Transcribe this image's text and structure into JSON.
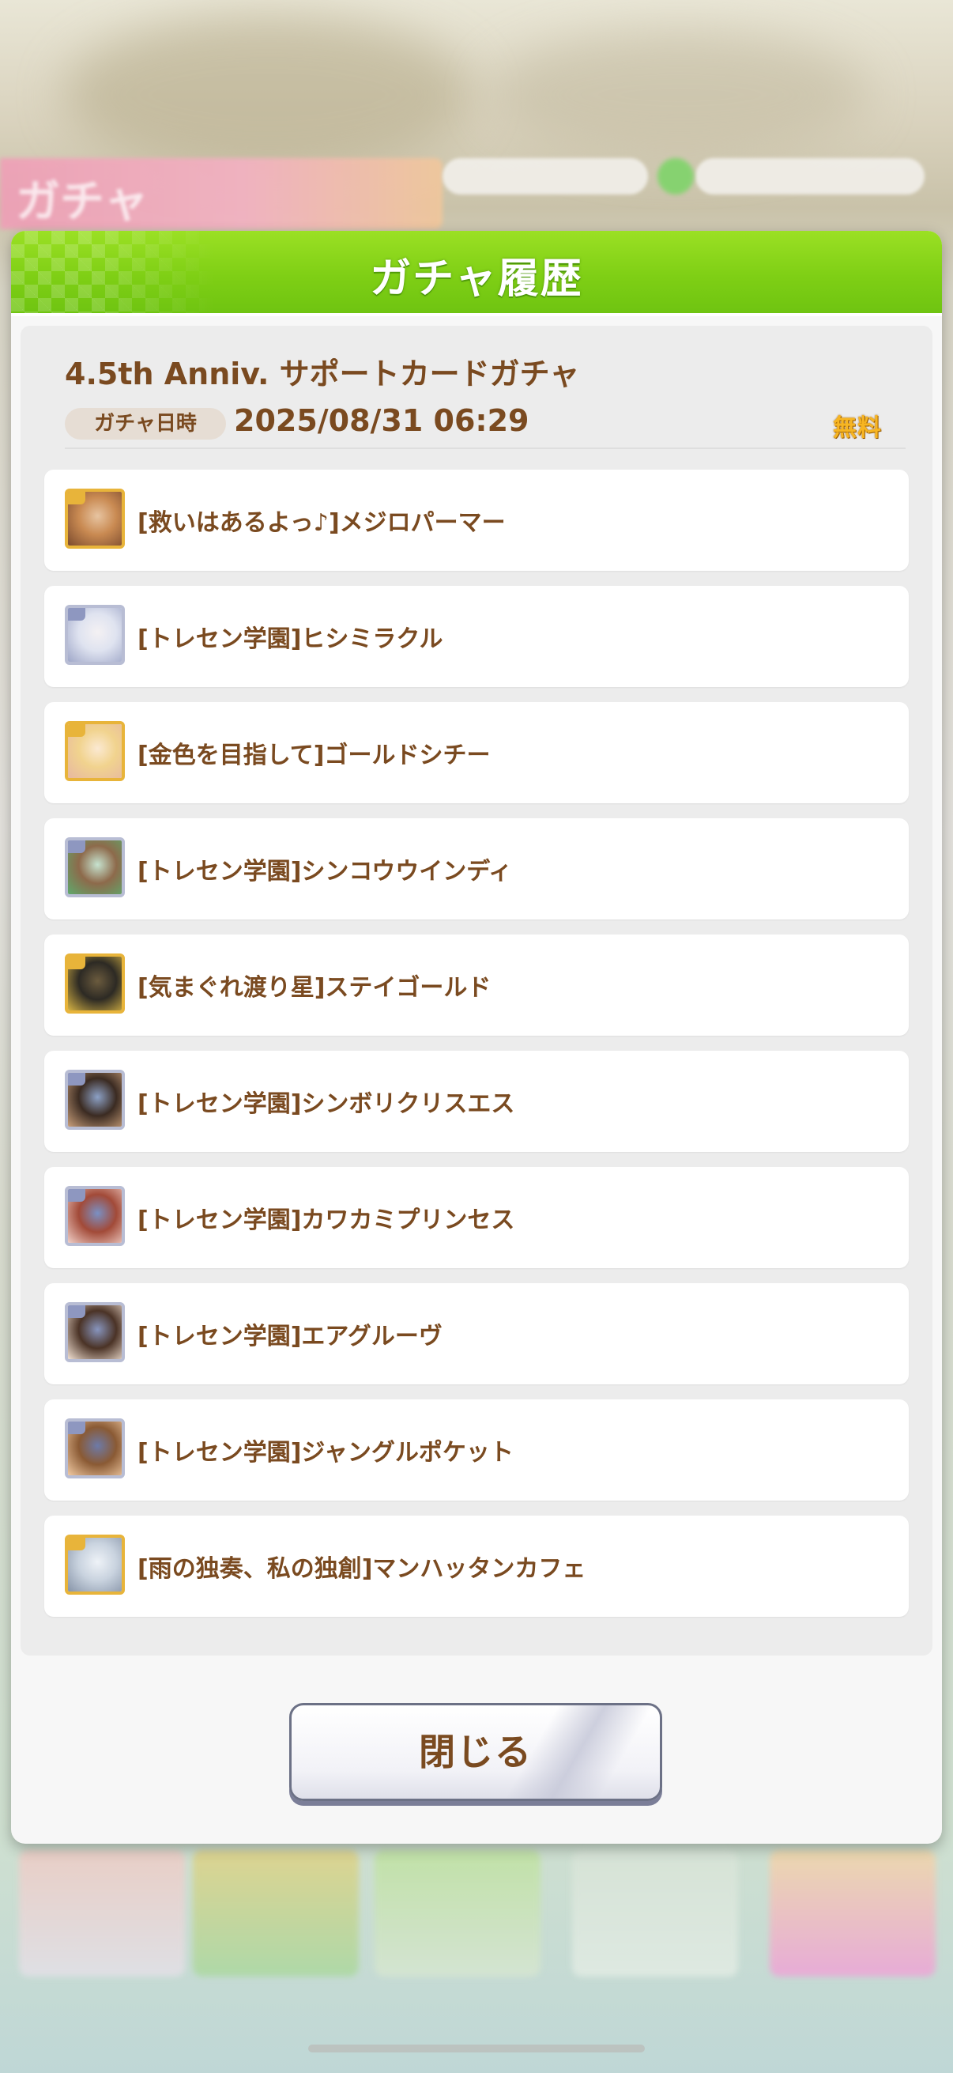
{
  "background": {
    "header_label": "ガチャ"
  },
  "dialog": {
    "title": "ガチャ履歴",
    "banner_name": "4.5th Anniv. サポートカードガチャ",
    "date_label": "ガチャ日時",
    "date_value": "2025/08/31 06:29",
    "free_badge": "無料",
    "results": [
      {
        "name": "[救いはあるよっ♪]メジロパーマー",
        "rarity": "SSR",
        "art_colors": [
          "#c98a52",
          "#7c4b2e",
          "#e7c4a1"
        ]
      },
      {
        "name": "[トレセン学園]ヒシミラクル",
        "rarity": "SR",
        "art_colors": [
          "#dfe3f0",
          "#9fa7c8",
          "#f4f1f3"
        ]
      },
      {
        "name": "[金色を目指して]ゴールドシチー",
        "rarity": "SSR",
        "art_colors": [
          "#f1d38e",
          "#e7b8a1",
          "#fbe9d2"
        ]
      },
      {
        "name": "[トレセン学園]シンコウウインディ",
        "rarity": "SR",
        "art_colors": [
          "#8d6a4b",
          "#5fa96c",
          "#c6e3cf"
        ]
      },
      {
        "name": "[気まぐれ渡り星]ステイゴールド",
        "rarity": "SSR",
        "art_colors": [
          "#2d2a24",
          "#d6b343",
          "#6b5b3e"
        ]
      },
      {
        "name": "[トレセン学園]シンボリクリスエス",
        "rarity": "SR",
        "art_colors": [
          "#3b2b22",
          "#c99f7a",
          "#8ca1c6"
        ]
      },
      {
        "name": "[トレセン学園]カワカミプリンセス",
        "rarity": "SR",
        "art_colors": [
          "#a24a38",
          "#f0cfc7",
          "#7a90c4"
        ]
      },
      {
        "name": "[トレセン学園]エアグルーヴ",
        "rarity": "SR",
        "art_colors": [
          "#4b3326",
          "#f1e0d2",
          "#8795be"
        ]
      },
      {
        "name": "[トレセン学園]ジャングルポケット",
        "rarity": "SR",
        "art_colors": [
          "#8a5a34",
          "#f0c9a2",
          "#6d7aa8"
        ]
      },
      {
        "name": "[雨の独奏、私の独創]マンハッタンカフェ",
        "rarity": "SSR",
        "art_colors": [
          "#c9d3df",
          "#8794a8",
          "#eef2f7"
        ]
      }
    ],
    "close_label": "閉じる"
  },
  "colors": {
    "header_green": "#7fcf15",
    "text_brown": "#7a4a20",
    "free_gold": "#f7b522",
    "ssr_frame": "#e8b43a",
    "sr_frame": "#b8bdd4"
  }
}
